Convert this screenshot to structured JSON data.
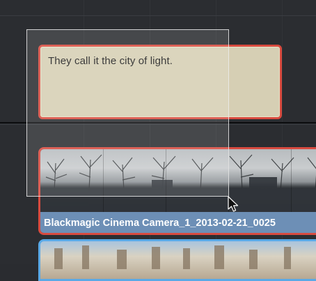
{
  "timeline": {
    "subtitle_clip": {
      "text": "They call it the city of light."
    },
    "video_clip": {
      "name": "Blackmagic Cinema Camera_1_2013-02-21_0025"
    },
    "colors": {
      "background": "#2b2d31",
      "selected_border": "#d84a3f",
      "subtitle_fill": "#d6cfb4",
      "clip_label_bar": "#6d8fb6",
      "lower_clip_border": "#5aa9e6"
    }
  },
  "cursor": {
    "icon": "arrow-pointer-icon"
  }
}
